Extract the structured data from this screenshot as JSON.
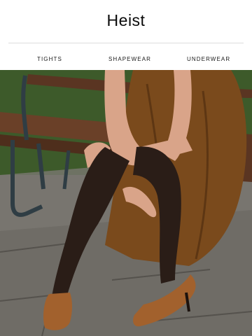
{
  "brand": {
    "logo_text": "Heist"
  },
  "nav": {
    "items": [
      {
        "label": "TIGHTS"
      },
      {
        "label": "SHAPEWEAR"
      },
      {
        "label": "UNDERWEAR"
      }
    ]
  },
  "hero": {
    "colors": {
      "pavement": "#6f6c66",
      "grass": "#3d5a2a",
      "bench_wood": "#5a3522",
      "bench_frame": "#2f3d44",
      "dress": "#7a4a1c",
      "tights": "#2a1d17",
      "skin": "#d9a489",
      "shoes": "#a2612d"
    }
  }
}
